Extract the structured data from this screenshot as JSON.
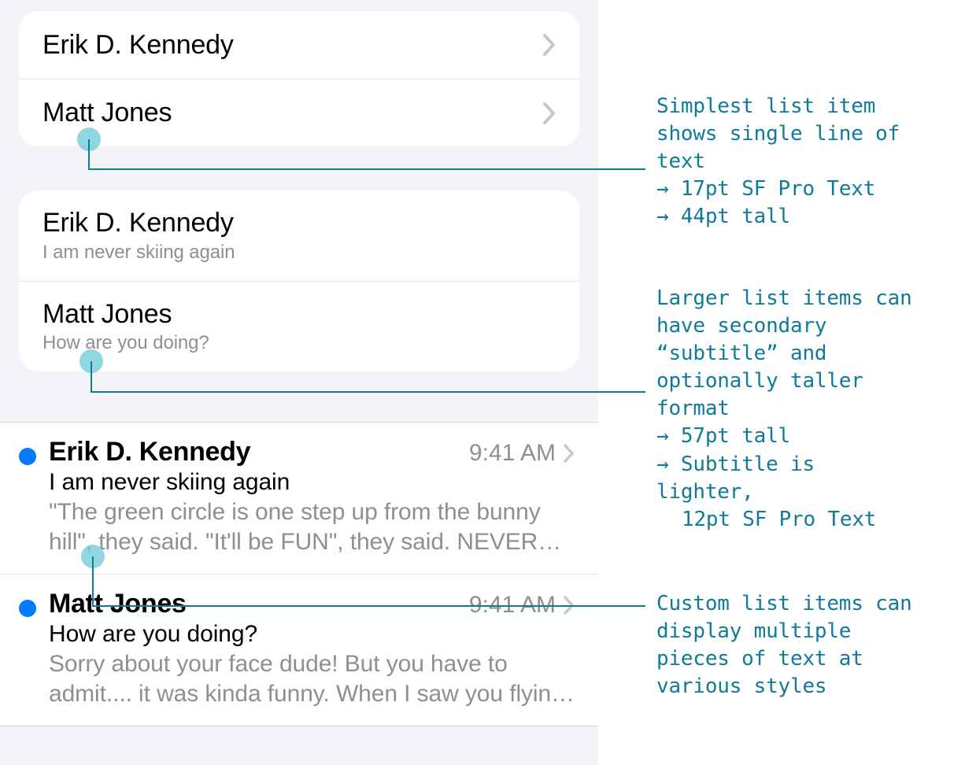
{
  "colors": {
    "accent": "#007aff",
    "anno": "#107a99",
    "muted": "#8e8e93"
  },
  "section_simple": {
    "items": [
      {
        "title": "Erik D. Kennedy"
      },
      {
        "title": "Matt Jones"
      }
    ]
  },
  "section_subtitle": {
    "items": [
      {
        "title": "Erik D. Kennedy",
        "subtitle": "I am never skiing again"
      },
      {
        "title": "Matt Jones",
        "subtitle": "How are you doing?"
      }
    ]
  },
  "section_custom": {
    "items": [
      {
        "name": "Erik D. Kennedy",
        "time": "9:41 AM",
        "subject": "I am never skiing again",
        "preview": "\"The green circle is one step up from the bunny hill\", they said. \"It'll be FUN\", they said. NEVER…"
      },
      {
        "name": "Matt Jones",
        "time": "9:41 AM",
        "subject": "How are you doing?",
        "preview": "Sorry about your face dude! But you have to admit.... it was kinda funny. When I saw you flyin…"
      }
    ]
  },
  "annotations": {
    "a1_l1": "Simplest list item",
    "a1_l2": "shows single line of",
    "a1_l3": "text",
    "a1_b1": "17pt SF Pro Text",
    "a1_b2": "44pt tall",
    "a2_l1": "Larger list items can",
    "a2_l2": "have secondary",
    "a2_l3": "“subtitle” and",
    "a2_l4": "optionally taller",
    "a2_l5": "format",
    "a2_b1": "57pt tall",
    "a2_b2": "Subtitle is",
    "a2_b3": "lighter,",
    "a2_b4": "12pt SF Pro Text",
    "a3_l1": "Custom list items can",
    "a3_l2": "display multiple",
    "a3_l3": "pieces of text at",
    "a3_l4": "various styles"
  }
}
